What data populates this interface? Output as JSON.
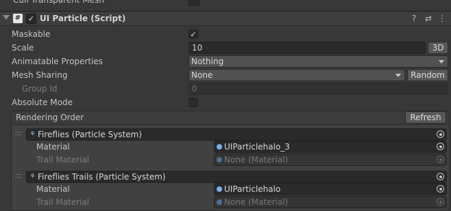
{
  "prev_row": {
    "label": "Cull Transparent Mesh"
  },
  "component": {
    "icon_glyph": "#",
    "enabled_mark": "✓",
    "title": "UI Particle (Script)",
    "help_icon": "question-circle-icon",
    "help_glyph": "?",
    "presets_icon": "sliders-icon",
    "presets_glyph": "⇄",
    "menu_icon": "kebab-menu-icon",
    "menu_glyph": "⋮"
  },
  "props": {
    "maskable": {
      "label": "Maskable",
      "checked_mark": "✓"
    },
    "scale": {
      "label": "Scale",
      "value": "10",
      "mode_button": "3D"
    },
    "animatable": {
      "label": "Animatable Properties",
      "value": "Nothing"
    },
    "mesh_sharing": {
      "label": "Mesh Sharing",
      "value": "None",
      "random_button": "Random"
    },
    "group_id": {
      "label": "Group Id",
      "value": "0"
    },
    "absolute_mode": {
      "label": "Absolute Mode"
    }
  },
  "rendering_order": {
    "title": "Rendering Order",
    "refresh_button": "Refresh",
    "items": [
      {
        "system": "Fireflies (Particle System)",
        "material_label": "Material",
        "material_value": "UIParticlehalo_3",
        "trail_label": "Trail Material",
        "trail_value": "None (Material)"
      },
      {
        "system": "Fireflies Trails (Particle System)",
        "material_label": "Material",
        "material_value": "UIParticlehalo",
        "trail_label": "Trail Material",
        "trail_value": "None (Material)"
      }
    ]
  },
  "colors": {
    "background": "#383838",
    "field": "#2a2a2a",
    "text": "#c4c4c4",
    "object_icon": "#79aef0"
  }
}
